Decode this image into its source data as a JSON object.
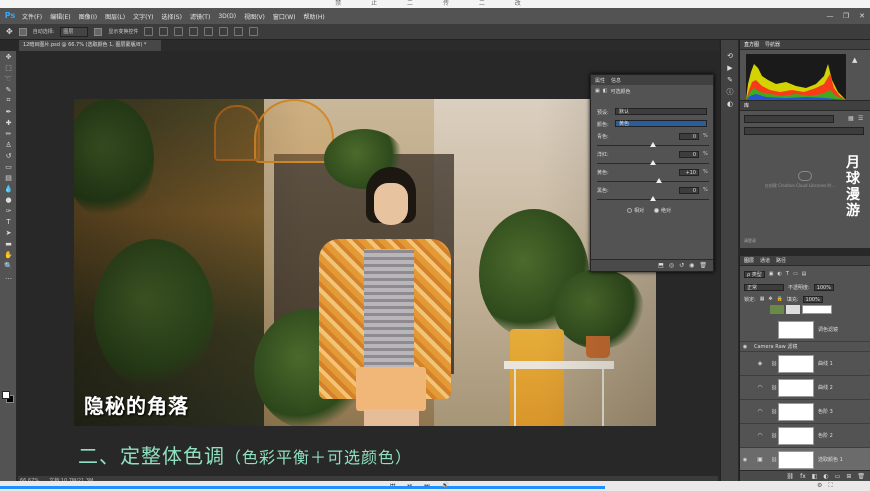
{
  "window": {
    "title_strip": "禁 止 二 传 二 改",
    "controls": [
      "—",
      "❐",
      "✕"
    ]
  },
  "menubar": {
    "logo": "Ps",
    "items": [
      "文件(F)",
      "编辑(E)",
      "图像(I)",
      "图层(L)",
      "文字(Y)",
      "选择(S)",
      "滤镜(T)",
      "3D(D)",
      "视图(V)",
      "窗口(W)",
      "帮助(H)"
    ]
  },
  "options": {
    "auto_select_label": "自动选择:",
    "auto_select_value": "图层",
    "show_transform_label": "显示变换控件"
  },
  "document": {
    "tab_title": "12暗目图片.psd @ 66.7% (选取颜色 1, 图层蒙版/8) *"
  },
  "canvas": {
    "photo_title": "隐秘的角落",
    "caption_main": "二、定整体色调",
    "caption_sub": "（色彩平衡＋可选颜色）"
  },
  "status": {
    "zoom": "66.67%",
    "doc_info": "文档:10.7M/21.3M"
  },
  "properties": {
    "tabs": [
      "属性",
      "信息"
    ],
    "header": "可选颜色",
    "preset_label": "预设:",
    "preset_value": "默认",
    "colors_label": "颜色:",
    "colors_value": "黄色",
    "sliders": [
      {
        "label": "青色:",
        "value": "0",
        "pct": "%",
        "level": 0
      },
      {
        "label": "洋红:",
        "value": "0",
        "pct": "%",
        "level": 0
      },
      {
        "label": "黄色:",
        "value": "+10",
        "pct": "%",
        "level": 10
      },
      {
        "label": "黑色:",
        "value": "0",
        "pct": "%",
        "level": 0
      }
    ],
    "method_relative": "相对",
    "method_absolute": "绝对",
    "method_selected": "绝对"
  },
  "histogram_panel": {
    "tabs": [
      "直方图",
      "导航器"
    ]
  },
  "library_panel": {
    "tabs": [
      "库"
    ],
    "cc_text": "在创建 Creative Cloud Libraries 时...",
    "footer": "请登录"
  },
  "watermark": {
    "text": "月球漫游"
  },
  "layers_panel": {
    "tabs": [
      "图层",
      "通道",
      "路径"
    ],
    "kind_label": "ρ 类型",
    "blend_mode": "正常",
    "opacity_label": "不透明度:",
    "opacity_value": "100%",
    "lock_label": "锁定:",
    "fill_label": "填充:",
    "fill_value": "100%",
    "layers": [
      {
        "name": "调色滤镜",
        "eye": "",
        "adj": "",
        "selected": false
      },
      {
        "name": "Camera Raw 滤镜",
        "eye": "◉",
        "adj": "",
        "selected": false
      },
      {
        "name": "曲线 1",
        "eye": "",
        "adj": "◈",
        "selected": false
      },
      {
        "name": "曲线 2",
        "eye": "",
        "adj": "◠",
        "selected": false
      },
      {
        "name": "色阶 3",
        "eye": "",
        "adj": "◠",
        "selected": false
      },
      {
        "name": "色阶 2",
        "eye": "",
        "adj": "◠",
        "selected": false
      },
      {
        "name": "选取颜色 1",
        "eye": "◉",
        "adj": "▣",
        "selected": true
      }
    ]
  },
  "player": {
    "progress": 0.695
  },
  "colors": {
    "accent_blue": "#1e90ff",
    "ps_blue": "#31a8ff",
    "caption_green": "#8ee0c0"
  }
}
